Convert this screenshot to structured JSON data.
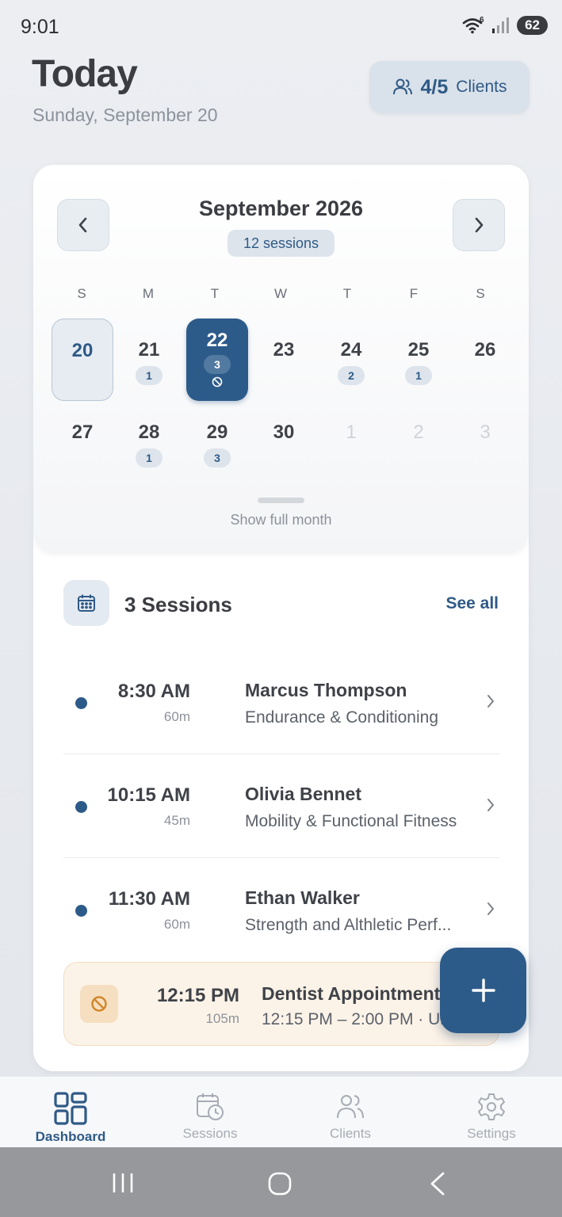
{
  "status": {
    "time": "9:01",
    "battery": "62",
    "wifi_badge": "6"
  },
  "header": {
    "title": "Today",
    "subtitle": "Sunday, September 20"
  },
  "clients_pill": {
    "count": "4/5",
    "label": "Clients",
    "icon": "users-icon"
  },
  "calendar": {
    "month": "September 2026",
    "sessions_badge": "12 sessions",
    "weekdays": [
      "S",
      "M",
      "T",
      "W",
      "T",
      "F",
      "S"
    ],
    "week1": [
      {
        "day": "20",
        "count": "",
        "state": "today"
      },
      {
        "day": "21",
        "count": "1"
      },
      {
        "day": "22",
        "count": "3",
        "state": "selected",
        "blocked": true
      },
      {
        "day": "23",
        "count": ""
      },
      {
        "day": "24",
        "count": "2"
      },
      {
        "day": "25",
        "count": "1"
      },
      {
        "day": "26",
        "count": ""
      }
    ],
    "week2": [
      {
        "day": "27",
        "count": ""
      },
      {
        "day": "28",
        "count": "1"
      },
      {
        "day": "29",
        "count": "3"
      },
      {
        "day": "30",
        "count": ""
      },
      {
        "day": "1",
        "count": "",
        "state": "muted"
      },
      {
        "day": "2",
        "count": "",
        "state": "muted"
      },
      {
        "day": "3",
        "count": "",
        "state": "muted"
      }
    ],
    "show_full_month": "Show full month"
  },
  "sessions": {
    "heading": "3 Sessions",
    "see_all": "See all",
    "items": [
      {
        "time": "8:30 AM",
        "duration": "60m",
        "client": "Marcus Thompson",
        "program": "Endurance & Conditioning"
      },
      {
        "time": "10:15 AM",
        "duration": "45m",
        "client": "Olivia Bennet",
        "program": "Mobility & Functional Fitness"
      },
      {
        "time": "11:30 AM",
        "duration": "60m",
        "client": "Ethan Walker",
        "program": "Strength and Althletic Perf..."
      }
    ],
    "appointment": {
      "time": "12:15 PM",
      "duration": "105m",
      "title": "Dentist Appointment",
      "detail": "12:15 PM – 2:00 PM · Un"
    }
  },
  "tabs": [
    {
      "label": "Dashboard",
      "icon": "dashboard-icon",
      "active": true
    },
    {
      "label": "Sessions",
      "icon": "calendar-clock-icon"
    },
    {
      "label": "Clients",
      "icon": "users-icon"
    },
    {
      "label": "Settings",
      "icon": "gear-icon"
    }
  ],
  "colors": {
    "accent": "#2d5b89",
    "accent_light": "#dde4ec",
    "appointment_bg": "#fcf3e8",
    "block_orange": "#d0862a"
  }
}
